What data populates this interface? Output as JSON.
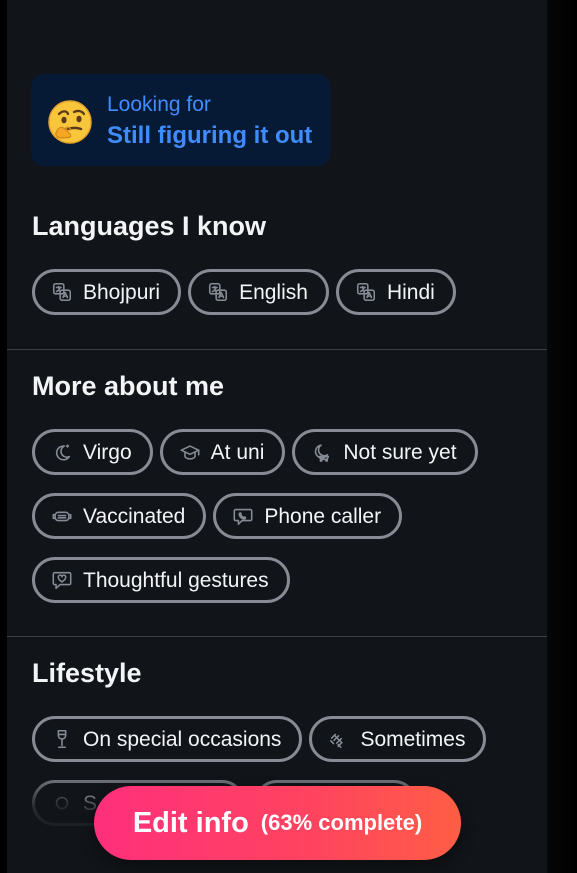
{
  "looking_for": {
    "emoji": "🤔",
    "label": "Looking for",
    "value": "Still figuring it out"
  },
  "languages": {
    "title": "Languages I know",
    "items": [
      {
        "label": "Bhojpuri",
        "icon": "translate-icon"
      },
      {
        "label": "English",
        "icon": "translate-icon"
      },
      {
        "label": "Hindi",
        "icon": "translate-icon"
      }
    ]
  },
  "more_about_me": {
    "title": "More about me",
    "items": [
      {
        "label": "Virgo",
        "icon": "moon-icon"
      },
      {
        "label": "At uni",
        "icon": "graduation-cap-icon"
      },
      {
        "label": "Not sure yet",
        "icon": "moon-stroller-icon"
      },
      {
        "label": "Vaccinated",
        "icon": "mask-icon"
      },
      {
        "label": "Phone caller",
        "icon": "phone-chat-icon"
      },
      {
        "label": "Thoughtful gestures",
        "icon": "heart-message-icon"
      }
    ]
  },
  "lifestyle": {
    "title": "Lifestyle",
    "items": [
      {
        "label": "On special occasions",
        "icon": "wine-glass-icon"
      },
      {
        "label": "Sometimes",
        "icon": "dumbbell-icon"
      },
      {
        "label": "S",
        "icon": "partially-hidden-icon"
      },
      {
        "label": "",
        "icon": "partially-hidden-icon"
      }
    ]
  },
  "edit_info": {
    "label": "Edit info",
    "progress": "(63% complete)"
  }
}
